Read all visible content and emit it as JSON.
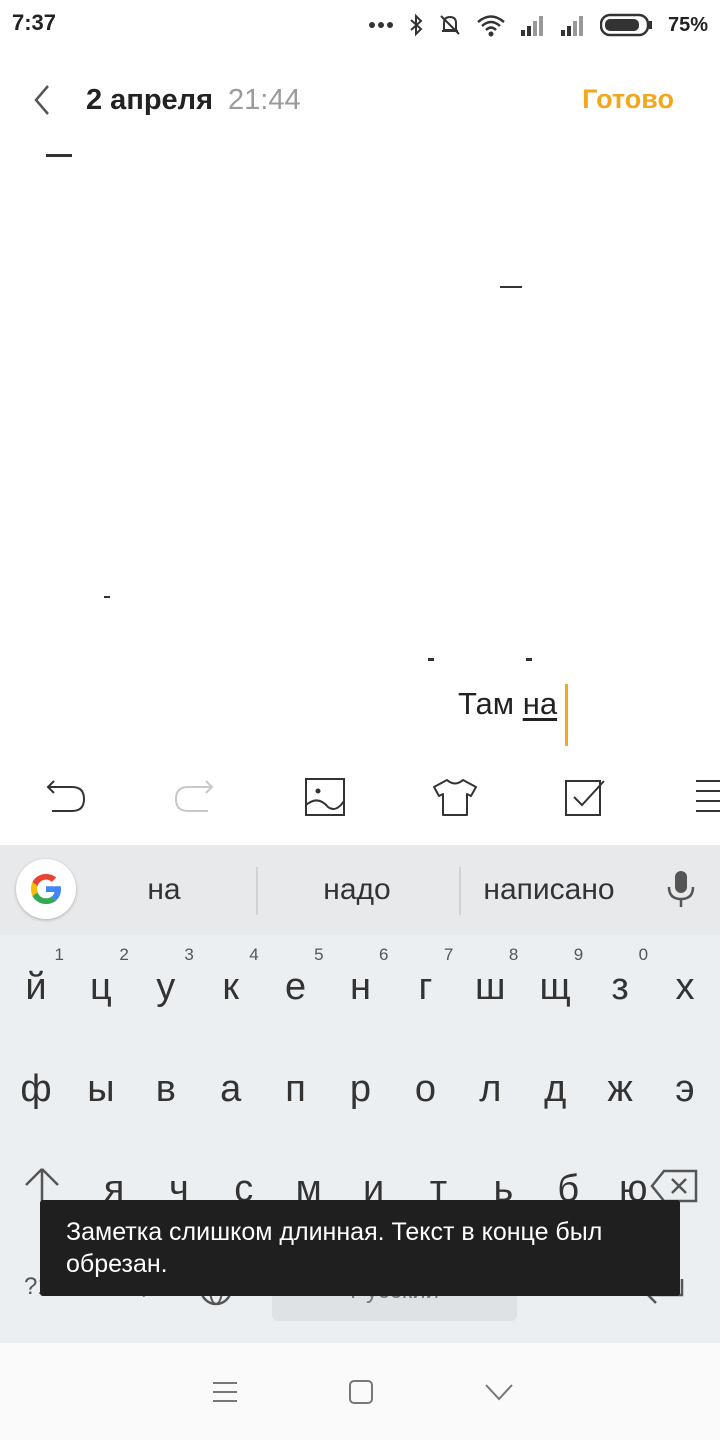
{
  "status_bar": {
    "time": "7:37",
    "battery": "75%",
    "icons": [
      "more-dots-icon",
      "bluetooth-icon",
      "bell-muted-icon",
      "wifi-icon",
      "signal-icon",
      "signal-icon",
      "battery-icon"
    ]
  },
  "header": {
    "date": "2 апреля",
    "time": "21:44",
    "done_label": "Готово"
  },
  "note": {
    "line_plain": "Там ",
    "line_underlined": "на"
  },
  "toolbar": {
    "icons": [
      "undo-icon",
      "redo-icon",
      "image-icon",
      "shirt-icon",
      "checkbox-icon",
      "format-list-icon"
    ]
  },
  "keyboard": {
    "suggestions": [
      "на",
      "надо",
      "написано"
    ],
    "row1": [
      {
        "k": "й",
        "h": "1"
      },
      {
        "k": "ц",
        "h": "2"
      },
      {
        "k": "у",
        "h": "3"
      },
      {
        "k": "к",
        "h": "4"
      },
      {
        "k": "е",
        "h": "5"
      },
      {
        "k": "н",
        "h": "6"
      },
      {
        "k": "г",
        "h": "7"
      },
      {
        "k": "ш",
        "h": "8"
      },
      {
        "k": "щ",
        "h": "9"
      },
      {
        "k": "з",
        "h": "0"
      },
      {
        "k": "х",
        "h": ""
      }
    ],
    "row2": [
      "ф",
      "ы",
      "в",
      "а",
      "п",
      "р",
      "о",
      "л",
      "д",
      "ж",
      "э"
    ],
    "row3": [
      "я",
      "ч",
      "с",
      "м",
      "и",
      "т",
      "ь",
      "б",
      "ю"
    ],
    "symbols_key": "?123",
    "comma_key": ",",
    "space_label": "Русский",
    "period_key": "."
  },
  "toast": {
    "message": "Заметка слишком длинная. Текст в конце был обрезан."
  },
  "colors": {
    "accent": "#f2a81d",
    "keyboard_bg": "#eceff1",
    "toast_bg": "#1f1f1f"
  }
}
